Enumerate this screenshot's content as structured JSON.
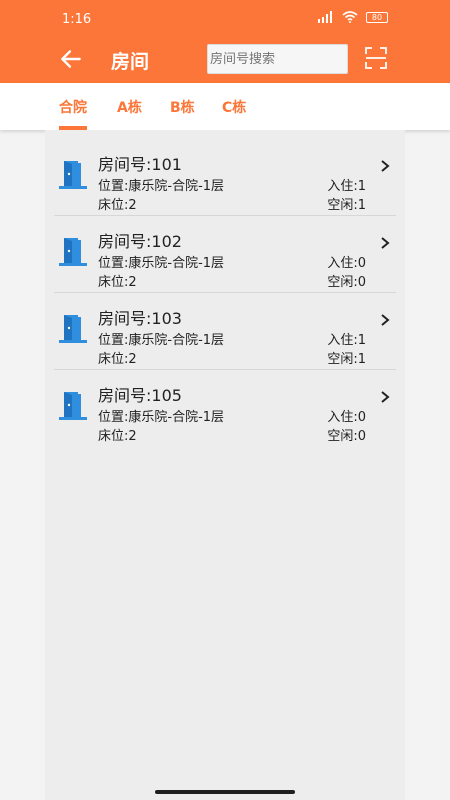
{
  "status_bar": {
    "time": "1:16",
    "battery": "80"
  },
  "app_bar": {
    "title": "房间",
    "search_placeholder": "房间号搜索"
  },
  "tabs": [
    {
      "label": "合院"
    },
    {
      "label": "A栋"
    },
    {
      "label": "B栋"
    },
    {
      "label": "C栋"
    }
  ],
  "rooms": [
    {
      "title": "房间号:101",
      "location": "位置:康乐院-合院-1层",
      "beds": "床位:2",
      "occupied": "入住:1",
      "free": "空闲:1"
    },
    {
      "title": "房间号:102",
      "location": "位置:康乐院-合院-1层",
      "beds": "床位:2",
      "occupied": "入住:0",
      "free": "空闲:0"
    },
    {
      "title": "房间号:103",
      "location": "位置:康乐院-合院-1层",
      "beds": "床位:2",
      "occupied": "入住:1",
      "free": "空闲:1"
    },
    {
      "title": "房间号:105",
      "location": "位置:康乐院-合院-1层",
      "beds": "床位:2",
      "occupied": "入住:0",
      "free": "空闲:0"
    }
  ],
  "colors": {
    "accent": "#fb7638",
    "door_icon": "#2f8fde"
  }
}
